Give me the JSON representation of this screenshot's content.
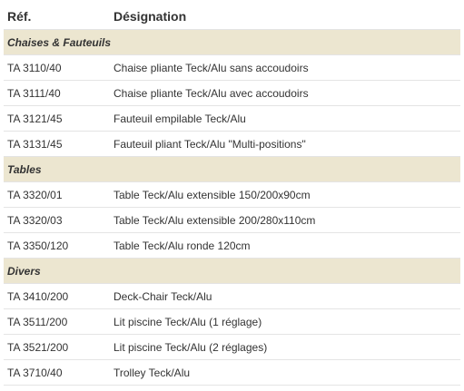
{
  "table": {
    "headers": {
      "ref": "Réf.",
      "designation": "Désignation"
    },
    "groups": [
      {
        "category": "Chaises & Fauteuils",
        "rows": [
          {
            "ref": "TA 3110/40",
            "designation": "Chaise pliante Teck/Alu sans accoudoirs"
          },
          {
            "ref": "TA 3111/40",
            "designation": "Chaise pliante Teck/Alu avec accoudoirs"
          },
          {
            "ref": "TA 3121/45",
            "designation": "Fauteuil empilable Teck/Alu"
          },
          {
            "ref": "TA 3131/45",
            "designation": "Fauteuil pliant Teck/Alu \"Multi-positions\""
          }
        ]
      },
      {
        "category": "Tables",
        "rows": [
          {
            "ref": "TA 3320/01",
            "designation": "Table Teck/Alu extensible 150/200x90cm"
          },
          {
            "ref": "TA 3320/03",
            "designation": "Table Teck/Alu extensible 200/280x110cm"
          },
          {
            "ref": "TA 3350/120",
            "designation": "Table Teck/Alu ronde 120cm"
          }
        ]
      },
      {
        "category": "Divers",
        "rows": [
          {
            "ref": "TA 3410/200",
            "designation": "Deck-Chair Teck/Alu"
          },
          {
            "ref": "TA 3511/200",
            "designation": "Lit piscine Teck/Alu (1 réglage)"
          },
          {
            "ref": "TA 3521/200",
            "designation": "Lit piscine Teck/Alu (2 réglages)"
          },
          {
            "ref": "TA 3710/40",
            "designation": "Trolley Teck/Alu"
          }
        ]
      }
    ]
  }
}
